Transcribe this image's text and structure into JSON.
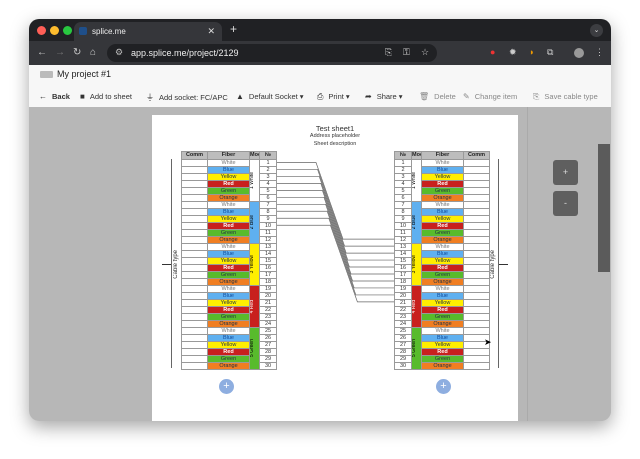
{
  "browser": {
    "tab_title": "splice.me",
    "url": "app.splice.me/project/2129",
    "colors": {
      "close": "#ff5f57",
      "minimize": "#febc2e",
      "maximize": "#28c840"
    }
  },
  "app": {
    "project_title": "My project #1"
  },
  "toolbar": {
    "back": "Back",
    "add_to_sheet": "Add to sheet",
    "add_socket": "Add socket: FC/APC",
    "default_socket": "Default Socket",
    "print": "Print",
    "share": "Share",
    "delete": "Delete",
    "change_item": "Change item",
    "save_cable_type": "Save cable type"
  },
  "zoom": {
    "in": "+",
    "out": "-"
  },
  "sheet": {
    "title": "Test sheet1",
    "address": "Address placeholder",
    "description": "Sheet description"
  },
  "columns": {
    "comm": "Comm",
    "fiber": "Fiber",
    "mod": "Mod",
    "num": "№"
  },
  "fiber_colors": {
    "White": "#ffffff",
    "Blue": "#5fb0f0",
    "Yellow": "#ffee00",
    "Red": "#c8201e",
    "Green": "#58bb2c",
    "Orange": "#f07e22"
  },
  "modules": [
    {
      "label": "1 White",
      "color": "#ffffff"
    },
    {
      "label": "2 Blue",
      "color": "#5fb0f0"
    },
    {
      "label": "3 Yellow",
      "color": "#ffee00"
    },
    {
      "label": "4 Red",
      "color": "#c8201e"
    },
    {
      "label": "5 Green",
      "color": "#58bb2c"
    }
  ],
  "left_cable": {
    "label": "Cable type",
    "numbers": [
      "1",
      "2",
      "3",
      "4",
      "5",
      "6",
      "7",
      "8",
      "9",
      "10",
      "11",
      "12",
      "13",
      "14",
      "15",
      "16",
      "17",
      "18",
      "19",
      "20",
      "21",
      "22",
      "23",
      "24",
      "25",
      "26",
      "27",
      "28",
      "29",
      "30"
    ],
    "fibers": [
      "White",
      "Blue",
      "Yellow",
      "Red",
      "Green",
      "Orange",
      "White",
      "Blue",
      "Yellow",
      "Red",
      "Green",
      "Orange",
      "White",
      "Blue",
      "Yellow",
      "Red",
      "Green",
      "Orange",
      "White",
      "Blue",
      "Yellow",
      "Red",
      "Green",
      "Orange",
      "White",
      "Blue",
      "Yellow",
      "Red",
      "Green",
      "Orange"
    ]
  },
  "right_cable": {
    "label": "Cable type",
    "numbers": [
      "1",
      "2",
      "3",
      "4",
      "5",
      "6",
      "7",
      "8",
      "9",
      "10",
      "11",
      "12",
      "13",
      "14",
      "15",
      "16",
      "17",
      "18",
      "19",
      "20",
      "21",
      "22",
      "23",
      "24",
      "25",
      "26",
      "27",
      "28",
      "29",
      "30"
    ],
    "fibers": [
      "White",
      "Blue",
      "Yellow",
      "Red",
      "Green",
      "Orange",
      "White",
      "Blue",
      "Yellow",
      "Red",
      "Green",
      "Orange",
      "White",
      "Blue",
      "Yellow",
      "Red",
      "Green",
      "Orange",
      "White",
      "Blue",
      "Yellow",
      "Red",
      "Green",
      "Orange",
      "White",
      "Blue",
      "Yellow",
      "Red",
      "Green",
      "Orange"
    ]
  },
  "splices": [
    [
      1,
      12
    ],
    [
      2,
      13
    ],
    [
      3,
      14
    ],
    [
      4,
      15
    ],
    [
      5,
      16
    ],
    [
      6,
      17
    ],
    [
      7,
      18
    ],
    [
      8,
      19
    ],
    [
      9,
      20
    ],
    [
      10,
      21
    ]
  ],
  "add_button": "+"
}
